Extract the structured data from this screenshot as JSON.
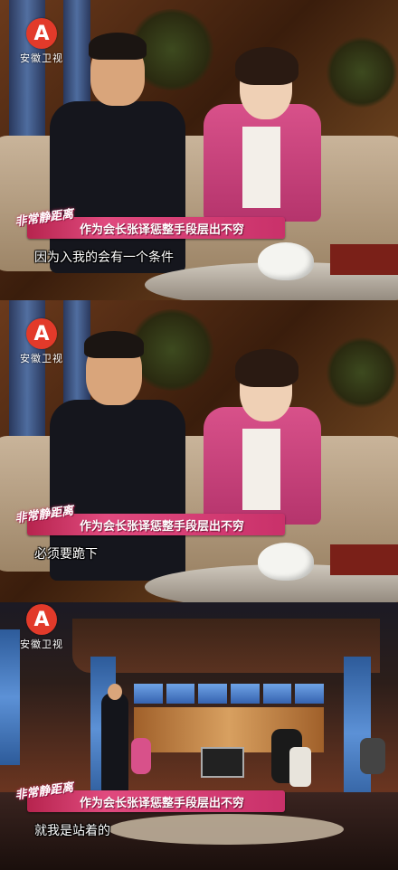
{
  "channel": {
    "name": "安徽卫视",
    "logo_glyph": "A"
  },
  "panels": [
    {
      "banner": {
        "show_logo": "非常静距离",
        "headline": "作为会长张译惩整手段层出不穷"
      },
      "subtitle": "因为入我的会有一个条件"
    },
    {
      "banner": {
        "show_logo": "非常静距离",
        "headline": "作为会长张译惩整手段层出不穷"
      },
      "subtitle": "必须要跪下"
    },
    {
      "banner": {
        "show_logo": "非常静距离",
        "headline": "作为会长张译惩整手段层出不穷"
      },
      "subtitle": "就我是站着的"
    }
  ],
  "colors": {
    "banner": "#d23a6e",
    "logo_red": "#e23a2a",
    "jacket_pink": "#d8518a"
  }
}
